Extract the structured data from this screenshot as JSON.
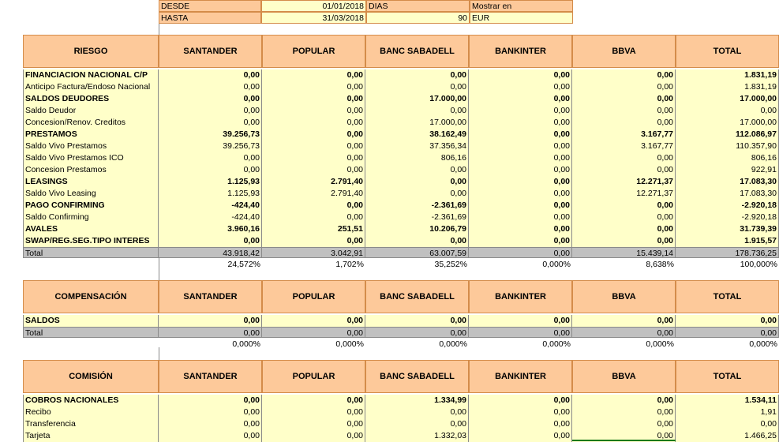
{
  "top": {
    "desde_label": "DESDE",
    "desde_value": "01/01/2018",
    "dias_label": "DIAS",
    "dias_value": "90",
    "mostrar_label": "Mostrar en",
    "hasta_label": "HASTA",
    "hasta_value": "31/03/2018",
    "currency": "EUR"
  },
  "columns": [
    "SANTANDER",
    "POPULAR",
    "BANC SABADELL",
    "BANKINTER",
    "BBVA",
    "TOTAL"
  ],
  "colors": {
    "header_bg": "#fdc99a",
    "cell_bg": "#ffffc9",
    "total_bg": "#c0c0c0",
    "header_border": "#d48c4a"
  },
  "riesgo": {
    "title": "RIESGO",
    "rows": [
      {
        "label": "FINANCIACION NACIONAL C/P",
        "bold": true,
        "values": [
          "0,00",
          "0,00",
          "0,00",
          "0,00",
          "0,00",
          "1.831,19"
        ]
      },
      {
        "label": "Anticipo Factura/Endoso Nacional",
        "bold": false,
        "values": [
          "0,00",
          "0,00",
          "0,00",
          "0,00",
          "0,00",
          "1.831,19"
        ]
      },
      {
        "label": "SALDOS DEUDORES",
        "bold": true,
        "values": [
          "0,00",
          "0,00",
          "17.000,00",
          "0,00",
          "0,00",
          "17.000,00"
        ]
      },
      {
        "label": "Saldo Deudor",
        "bold": false,
        "values": [
          "0,00",
          "0,00",
          "0,00",
          "0,00",
          "0,00",
          "0,00"
        ]
      },
      {
        "label": "Concesion/Renov. Creditos",
        "bold": false,
        "values": [
          "0,00",
          "0,00",
          "17.000,00",
          "0,00",
          "0,00",
          "17.000,00"
        ]
      },
      {
        "label": "PRESTAMOS",
        "bold": true,
        "values": [
          "39.256,73",
          "0,00",
          "38.162,49",
          "0,00",
          "3.167,77",
          "112.086,97"
        ]
      },
      {
        "label": "Saldo Vivo Prestamos",
        "bold": false,
        "values": [
          "39.256,73",
          "0,00",
          "37.356,34",
          "0,00",
          "3.167,77",
          "110.357,90"
        ]
      },
      {
        "label": "Saldo Vivo Prestamos ICO",
        "bold": false,
        "values": [
          "0,00",
          "0,00",
          "806,16",
          "0,00",
          "0,00",
          "806,16"
        ]
      },
      {
        "label": "Concesion Prestamos",
        "bold": false,
        "values": [
          "0,00",
          "0,00",
          "0,00",
          "0,00",
          "0,00",
          "922,91"
        ]
      },
      {
        "label": "LEASINGS",
        "bold": true,
        "values": [
          "1.125,93",
          "2.791,40",
          "0,00",
          "0,00",
          "12.271,37",
          "17.083,30"
        ]
      },
      {
        "label": "Saldo Vivo Leasing",
        "bold": false,
        "values": [
          "1.125,93",
          "2.791,40",
          "0,00",
          "0,00",
          "12.271,37",
          "17.083,30"
        ]
      },
      {
        "label": "PAGO CONFIRMING",
        "bold": true,
        "values": [
          "-424,40",
          "0,00",
          "-2.361,69",
          "0,00",
          "0,00",
          "-2.920,18"
        ]
      },
      {
        "label": "Saldo Confirming",
        "bold": false,
        "values": [
          "-424,40",
          "0,00",
          "-2.361,69",
          "0,00",
          "0,00",
          "-2.920,18"
        ]
      },
      {
        "label": "AVALES",
        "bold": true,
        "values": [
          "3.960,16",
          "251,51",
          "10.206,79",
          "0,00",
          "0,00",
          "31.739,39"
        ]
      },
      {
        "label": "SWAP/REG.SEG.TIPO INTERES",
        "bold": true,
        "values": [
          "0,00",
          "0,00",
          "0,00",
          "0,00",
          "0,00",
          "1.915,57"
        ]
      }
    ],
    "total": {
      "label": "Total",
      "values": [
        "43.918,42",
        "3.042,91",
        "63.007,59",
        "0,00",
        "15.439,14",
        "178.736,25"
      ]
    },
    "percents": [
      "24,572%",
      "1,702%",
      "35,252%",
      "0,000%",
      "8,638%",
      "100,000%"
    ]
  },
  "compensacion": {
    "title": "COMPENSACIÓN",
    "rows": [
      {
        "label": "SALDOS",
        "bold": true,
        "values": [
          "0,00",
          "0,00",
          "0,00",
          "0,00",
          "0,00",
          "0,00"
        ]
      }
    ],
    "total": {
      "label": "Total",
      "values": [
        "0,00",
        "0,00",
        "0,00",
        "0,00",
        "0,00",
        "0,00"
      ]
    },
    "percents": [
      "0,000%",
      "0,000%",
      "0,000%",
      "0,000%",
      "0,000%",
      "0,000%"
    ]
  },
  "comision": {
    "title": "COMISIÓN",
    "rows": [
      {
        "label": "COBROS NACIONALES",
        "bold": true,
        "values": [
          "0,00",
          "0,00",
          "1.334,99",
          "0,00",
          "0,00",
          "1.534,11"
        ]
      },
      {
        "label": "Recibo",
        "bold": false,
        "values": [
          "0,00",
          "0,00",
          "0,00",
          "0,00",
          "0,00",
          "1,91"
        ]
      },
      {
        "label": "Transferencia",
        "bold": false,
        "values": [
          "0,00",
          "0,00",
          "0,00",
          "0,00",
          "0,00",
          "0,00"
        ]
      },
      {
        "label": "Tarjeta",
        "bold": false,
        "values": [
          "0,00",
          "0,00",
          "1.332,03",
          "0,00",
          "0,00",
          "1.466,25"
        ]
      }
    ]
  }
}
